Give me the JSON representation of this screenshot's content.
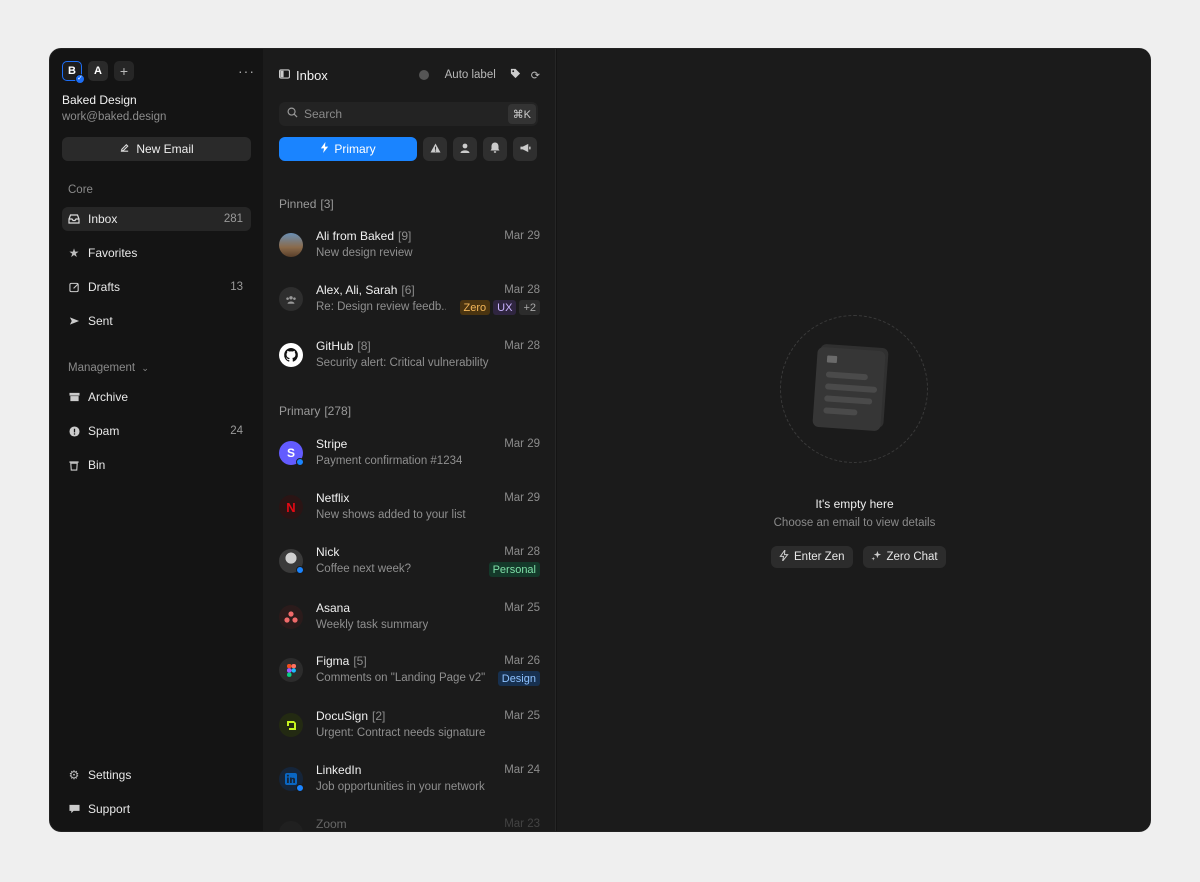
{
  "accounts": [
    {
      "initial": "B",
      "active": true
    },
    {
      "initial": "A",
      "active": false
    }
  ],
  "add_account_label": "+",
  "more_label": "···",
  "org": {
    "name": "Baked Design",
    "email": "work@baked.design"
  },
  "new_email_label": "New Email",
  "sections": {
    "core": "Core",
    "management": "Management"
  },
  "nav": {
    "inbox": {
      "label": "Inbox",
      "count": "281"
    },
    "favorites": {
      "label": "Favorites",
      "count": ""
    },
    "drafts": {
      "label": "Drafts",
      "count": "13"
    },
    "sent": {
      "label": "Sent",
      "count": ""
    },
    "archive": {
      "label": "Archive",
      "count": ""
    },
    "spam": {
      "label": "Spam",
      "count": "24"
    },
    "bin": {
      "label": "Bin",
      "count": ""
    },
    "settings": {
      "label": "Settings"
    },
    "support": {
      "label": "Support"
    }
  },
  "list": {
    "title": "Inbox",
    "auto_label": "Auto label",
    "search_placeholder": "Search",
    "search_shortcut": "⌘K",
    "primary_label": "Primary",
    "pinned_label": "Pinned",
    "pinned_count": "[3]",
    "primary_group_label": "Primary",
    "primary_group_count": "[278]"
  },
  "pinned": [
    {
      "sender": "Ali from Baked",
      "count": "[9]",
      "date": "Mar 29",
      "subject": "New design review",
      "avatar": "photo-ali",
      "tags": []
    },
    {
      "sender": "Alex, Ali, Sarah",
      "count": "[6]",
      "date": "Mar 28",
      "subject": "Re: Design review feedb...",
      "avatar": "group",
      "tags": [
        {
          "label": "Zero",
          "bg": "#4a3410",
          "fg": "#f3b75a"
        },
        {
          "label": "UX",
          "bg": "#2f2540",
          "fg": "#c9b3ff"
        },
        {
          "label": "+2",
          "bg": "#2c2c2c",
          "fg": "#a8a8a8"
        }
      ]
    },
    {
      "sender": "GitHub",
      "count": "[8]",
      "date": "Mar 28",
      "subject": "Security alert: Critical vulnerability",
      "avatar": "github",
      "tags": []
    }
  ],
  "primary": [
    {
      "sender": "Stripe",
      "count": "",
      "date": "Mar 29",
      "subject": "Payment confirmation #1234",
      "avatar": "stripe",
      "unread": true,
      "tags": []
    },
    {
      "sender": "Netflix",
      "count": "",
      "date": "Mar 29",
      "subject": "New shows added to your list",
      "avatar": "netflix",
      "unread": false,
      "tags": []
    },
    {
      "sender": "Nick",
      "count": "",
      "date": "Mar 28",
      "subject": "Coffee next week?",
      "avatar": "photo-nick",
      "unread": true,
      "tags": [
        {
          "label": "Personal",
          "bg": "#14392a",
          "fg": "#7fe0a8"
        }
      ]
    },
    {
      "sender": "Asana",
      "count": "",
      "date": "Mar 25",
      "subject": "Weekly task summary",
      "avatar": "asana",
      "unread": false,
      "tags": []
    },
    {
      "sender": "Figma",
      "count": "[5]",
      "date": "Mar 26",
      "subject": "Comments on \"Landing Page v2\"",
      "avatar": "figma",
      "unread": false,
      "tags": [
        {
          "label": "Design",
          "bg": "#17304f",
          "fg": "#8ec2ff"
        }
      ]
    },
    {
      "sender": "DocuSign",
      "count": "[2]",
      "date": "Mar 25",
      "subject": "Urgent: Contract needs signature",
      "avatar": "docusign",
      "unread": false,
      "tags": []
    },
    {
      "sender": "LinkedIn",
      "count": "",
      "date": "Mar 24",
      "subject": "Job opportunities in your network",
      "avatar": "linkedin",
      "unread": true,
      "tags": []
    },
    {
      "sender": "Zoom",
      "count": "",
      "date": "Mar 23",
      "subject": "",
      "avatar": "zoom",
      "unread": false,
      "tags": []
    }
  ],
  "detail": {
    "empty_title": "It's empty here",
    "empty_sub": "Choose an email to view details",
    "enter_zen": "Enter Zen",
    "zero_chat": "Zero Chat"
  },
  "colors": {
    "accent": "#1a84ff",
    "background": "#141414",
    "panel": "#1b1b1b"
  }
}
